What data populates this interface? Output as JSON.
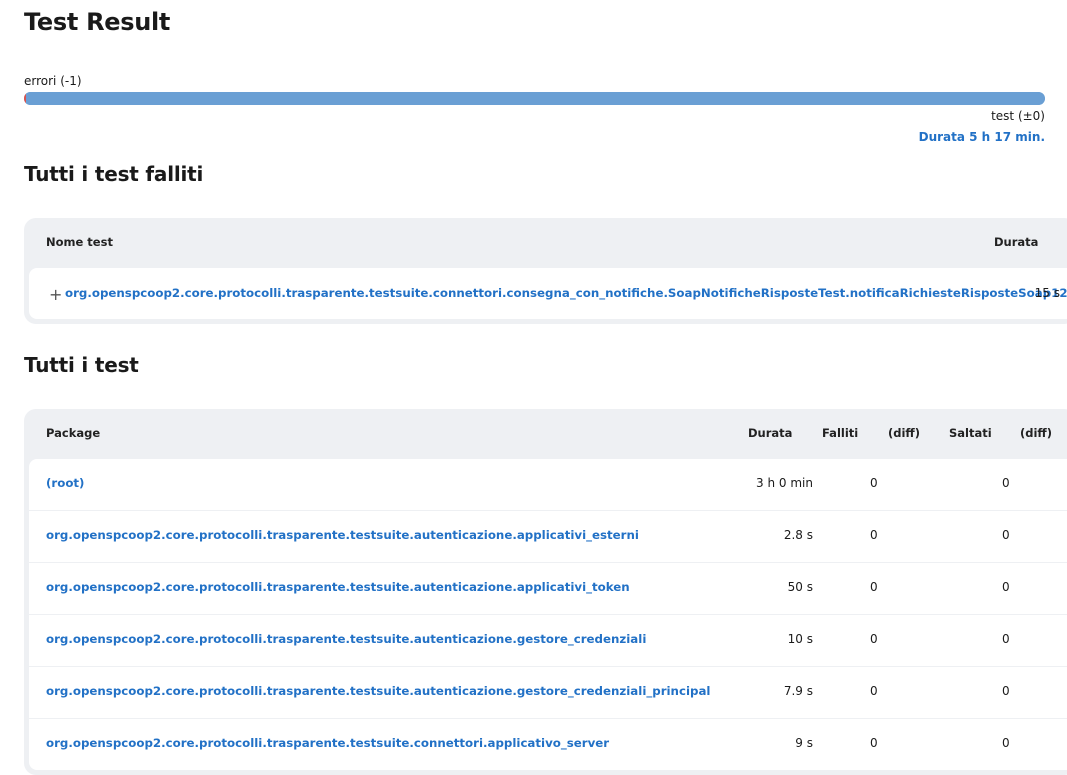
{
  "page_title": "Test Result",
  "trend": {
    "errors_label": "errori (-1)",
    "tests_label": "test (±0)",
    "duration_label": "Durata 5 h 17 min.",
    "fail_fraction": 0.002,
    "colors": {
      "fail": "#d9534f",
      "pass": "#6a9fd4"
    }
  },
  "failed_section": {
    "title": "Tutti i test falliti",
    "headers": {
      "name": "Nome test",
      "duration": "Durata"
    },
    "rows": [
      {
        "name": "org.openspcoop2.core.protocolli.trasparente.testsuite.connettori.consegna_con_notifiche.SoapNotificheRisposteTest.notificaRichiesteRisposteSoap12",
        "duration": "15 s",
        "expand_icon": "plus-icon"
      }
    ]
  },
  "all_section": {
    "title": "Tutti i test",
    "headers": {
      "package": "Package",
      "duration": "Durata",
      "failed": "Falliti",
      "diff1": "(diff)",
      "skipped": "Saltati",
      "diff2": "(diff)"
    },
    "rows": [
      {
        "name": "(root)",
        "duration": "3 h 0 min",
        "failed": "0",
        "skipped": "0"
      },
      {
        "name": "org.openspcoop2.core.protocolli.trasparente.testsuite.autenticazione.applicativi_esterni",
        "duration": "2.8 s",
        "failed": "0",
        "skipped": "0"
      },
      {
        "name": "org.openspcoop2.core.protocolli.trasparente.testsuite.autenticazione.applicativi_token",
        "duration": "50 s",
        "failed": "0",
        "skipped": "0"
      },
      {
        "name": "org.openspcoop2.core.protocolli.trasparente.testsuite.autenticazione.gestore_credenziali",
        "duration": "10 s",
        "failed": "0",
        "skipped": "0"
      },
      {
        "name": "org.openspcoop2.core.protocolli.trasparente.testsuite.autenticazione.gestore_credenziali_principal",
        "duration": "7.9 s",
        "failed": "0",
        "skipped": "0"
      },
      {
        "name": "org.openspcoop2.core.protocolli.trasparente.testsuite.connettori.applicativo_server",
        "duration": "9 s",
        "failed": "0",
        "skipped": "0"
      }
    ]
  }
}
